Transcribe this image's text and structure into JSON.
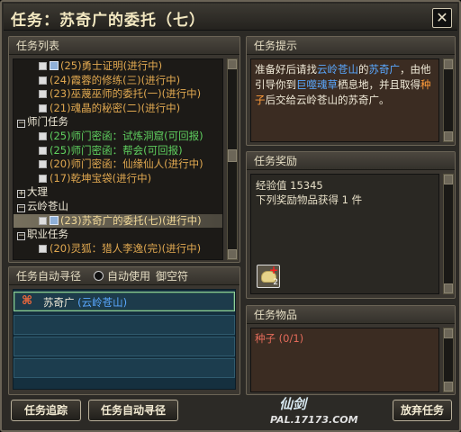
{
  "window": {
    "title": "任务：苏奇广的委托（七）",
    "close_label": "✕"
  },
  "task_list": {
    "header": "任务列表",
    "rows": [
      {
        "kind": "task",
        "icon": true,
        "text": "(25)勇士证明(进行中)",
        "color": "brown"
      },
      {
        "kind": "task",
        "icon": false,
        "text": "(24)霞蓉的修练(三)(进行中)",
        "color": "brown"
      },
      {
        "kind": "task",
        "icon": false,
        "text": "(23)巫蔑巫师的委托(一)(进行中)",
        "color": "brown"
      },
      {
        "kind": "task",
        "icon": false,
        "text": "(21)魂晶的秘密(二)(进行中)",
        "color": "brown"
      },
      {
        "kind": "group",
        "text": "师门任务",
        "exp": "−"
      },
      {
        "kind": "task",
        "icon": false,
        "text": "(25)师门密函：试炼洞窟(可回报)",
        "color": "green"
      },
      {
        "kind": "task",
        "icon": false,
        "text": "(25)师门密函：帮会(可回报)",
        "color": "green"
      },
      {
        "kind": "task",
        "icon": false,
        "text": "(20)师门密函：仙缘仙人(进行中)",
        "color": "brown"
      },
      {
        "kind": "task",
        "icon": false,
        "text": "(17)乾坤宝袋(进行中)",
        "color": "brown"
      },
      {
        "kind": "group",
        "text": "大理",
        "exp": "+"
      },
      {
        "kind": "group",
        "text": "云岭苍山",
        "exp": "−"
      },
      {
        "kind": "task",
        "icon": true,
        "text": "(23)苏奇广的委托(七)(进行中)",
        "color": "brown",
        "selected": true
      },
      {
        "kind": "group",
        "text": "职业任务",
        "exp": "−"
      },
      {
        "kind": "task",
        "icon": false,
        "text": "(20)灵狐：猎人李逸(完)(进行中)",
        "color": "brown"
      }
    ]
  },
  "hint": {
    "header": "任务提示",
    "parts": [
      {
        "t": "准备好后请找",
        "c": ""
      },
      {
        "t": "云岭苍山",
        "c": "blue"
      },
      {
        "t": "的",
        "c": ""
      },
      {
        "t": "苏奇广",
        "c": "blue"
      },
      {
        "t": "，由他引导你到",
        "c": ""
      },
      {
        "t": "巨噬魂草",
        "c": "blue"
      },
      {
        "t": "栖息地，并且取得",
        "c": ""
      },
      {
        "t": "种子",
        "c": "orange"
      },
      {
        "t": "后交给云岭苍山的苏奇广。",
        "c": ""
      }
    ]
  },
  "reward": {
    "header": "任务奖励",
    "exp_label": "经验值 15345",
    "items_label": "下列奖励物品获得 1 件",
    "item_plus": "+",
    "item_count": "2"
  },
  "goods": {
    "header": "任务物品",
    "item": "种子 (0/1)"
  },
  "path": {
    "header": "任务自动寻径",
    "auto_use_label": "自动使用",
    "item_name": "御空符",
    "npc_name": "苏奇广",
    "npc_location": "(云岭苍山)"
  },
  "buttons": {
    "track": "任务追踪",
    "auto_path": "任务自动寻径",
    "abandon": "放弃任务"
  },
  "watermark": {
    "line1": "仙剑",
    "line2": "PAL.17173.COM"
  }
}
